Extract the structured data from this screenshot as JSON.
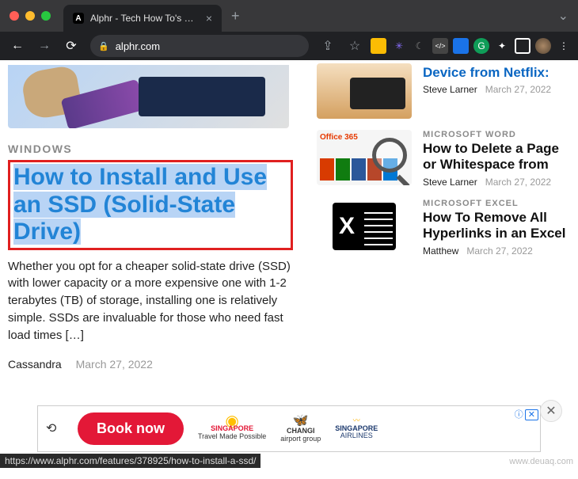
{
  "browser": {
    "tab_title": "Alphr - Tech How To's & Guide",
    "url": "alphr.com",
    "status_url": "https://www.alphr.com/features/378925/how-to-install-a-ssd/"
  },
  "main": {
    "category": "WINDOWS",
    "headline": "How to Install and Use an SSD (Solid-State Drive)",
    "excerpt": "Whether you opt for a cheaper solid-state drive (SSD) with lower capacity or a more expensive one with 1-2 terabytes (TB) of storage, installing one is relatively simple. SSDs are invaluable for those who need fast load times […]",
    "author": "Cassandra",
    "date": "March 27, 2022"
  },
  "sidebar": [
    {
      "category": "",
      "title": "Device from Netflix:",
      "author": "Steve Larner",
      "date": "March 27, 2022"
    },
    {
      "category": "MICROSOFT WORD",
      "title": "How to Delete a Page or Whitespace from",
      "author": "Steve Larner",
      "date": "March 27, 2022",
      "thumb_label": "Office 365"
    },
    {
      "category": "MICROSOFT EXCEL",
      "title": "How To Remove All Hyperlinks in an Excel",
      "author": "Matthew",
      "date": "March 27, 2022"
    }
  ],
  "ad": {
    "cta": "Book now",
    "info": "ⓘ",
    "logos": [
      {
        "top": "SINGAPORE",
        "sub": "Travel Made Possible"
      },
      {
        "top": "CHANGI",
        "sub": "airport group"
      },
      {
        "top": "SINGAPORE",
        "sub": "AIRLINES"
      }
    ]
  },
  "watermark": "www.deuaq.com"
}
